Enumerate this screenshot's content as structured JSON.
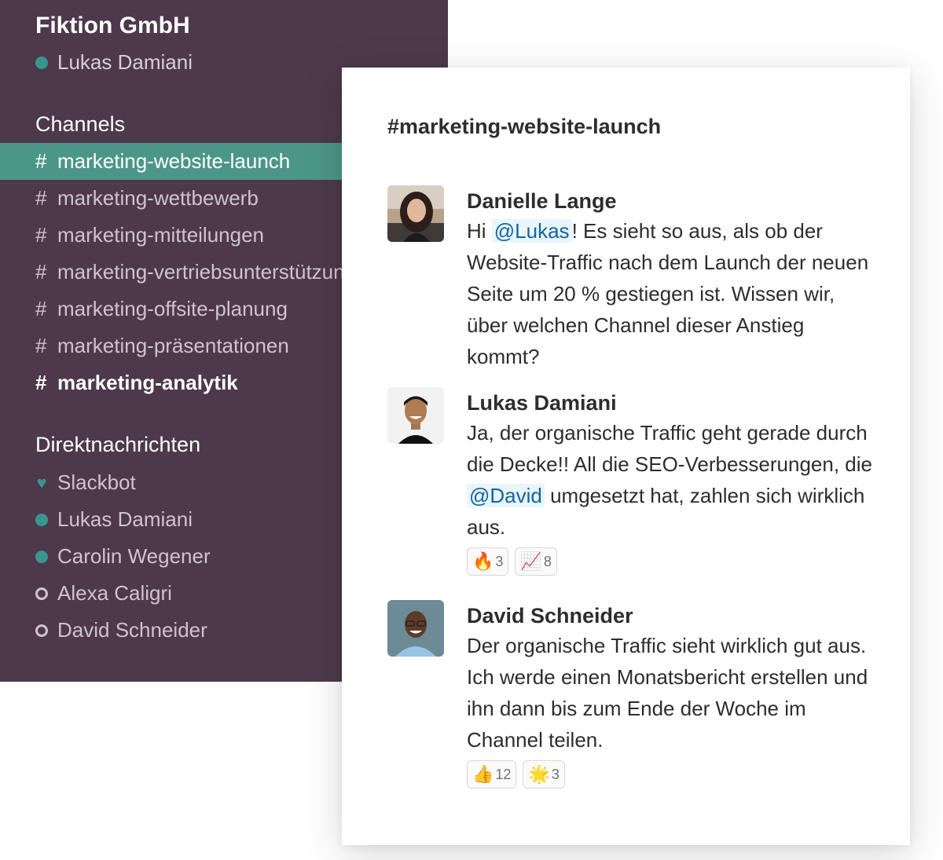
{
  "workspace": {
    "name": "Fiktion GmbH",
    "current_user": "Lukas Damiani"
  },
  "sidebar": {
    "channels_title": "Channels",
    "channels": [
      {
        "hash": "#",
        "label": "marketing-website-launch"
      },
      {
        "hash": "#",
        "label": "marketing-wettbewerb"
      },
      {
        "hash": "#",
        "label": "marketing-mitteilungen"
      },
      {
        "hash": "#",
        "label": "marketing-vertriebsunterstützung"
      },
      {
        "hash": "#",
        "label": "marketing-offsite-planung"
      },
      {
        "hash": "#",
        "label": "marketing-präsentationen"
      },
      {
        "hash": "#",
        "label": "marketing-analytik"
      }
    ],
    "dms_title": "Direktnachrichten",
    "dms": [
      {
        "label": "Slackbot",
        "status": "heart"
      },
      {
        "label": "Lukas Damiani",
        "status": "online"
      },
      {
        "label": "Carolin Wegener",
        "status": "online"
      },
      {
        "label": "Alexa Caligri",
        "status": "away"
      },
      {
        "label": "David Schneider",
        "status": "away"
      }
    ]
  },
  "main": {
    "channel_title": "#marketing-website-launch",
    "messages": [
      {
        "author": "Danielle Lange",
        "text_before": "Hi ",
        "mention": "@Lukas",
        "text_after": "! Es sieht so aus, als ob der Website-Traffic nach dem Launch der neuen Seite um 20 % gestiegen ist. Wissen wir, über welchen Channel dieser Anstieg kommt?"
      },
      {
        "author": "Lukas Damiani",
        "text_before": "Ja, der organische Traffic geht gerade durch die Decke!! All die SEO-Verbesserungen, die ",
        "mention": "@David",
        "text_after": " umgesetzt hat, zahlen sich wirklich aus.",
        "reactions": [
          {
            "emoji": "🔥",
            "count": "3"
          },
          {
            "emoji": "📈",
            "count": "8"
          }
        ]
      },
      {
        "author": "David Schneider",
        "text": "Der organische Traffic sieht wirklich gut aus. Ich werde einen Monatsbericht erstellen und ihn dann bis zum Ende der Woche im Channel teilen.",
        "reactions": [
          {
            "emoji": "👍",
            "count": "12"
          },
          {
            "emoji": "🌟",
            "count": "3"
          }
        ]
      }
    ]
  },
  "colors": {
    "sidebar_bg": "#4d394b",
    "active_channel": "#4c9689",
    "presence_online": "#38978d",
    "mention_text": "#1264a3",
    "mention_bg": "#e8f5fa"
  }
}
